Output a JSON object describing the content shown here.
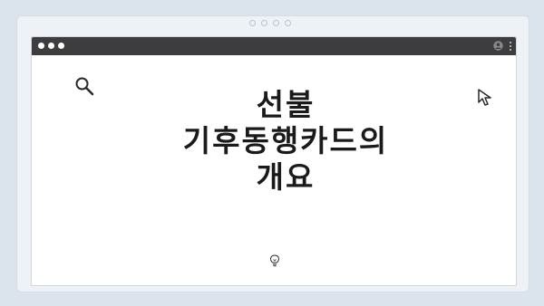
{
  "window": {
    "title_lines": [
      "선불",
      "기후동행카드의",
      "개요"
    ]
  },
  "icons": {
    "search": "search-icon",
    "cursor": "cursor-icon",
    "bulb": "lightbulb-icon",
    "user": "user-icon",
    "menu": "kebab-menu-icon"
  },
  "colors": {
    "background": "#dbe3ec",
    "frame": "#eef2f6",
    "titlebar": "#3d3d3f",
    "text": "#1a1a1a"
  }
}
